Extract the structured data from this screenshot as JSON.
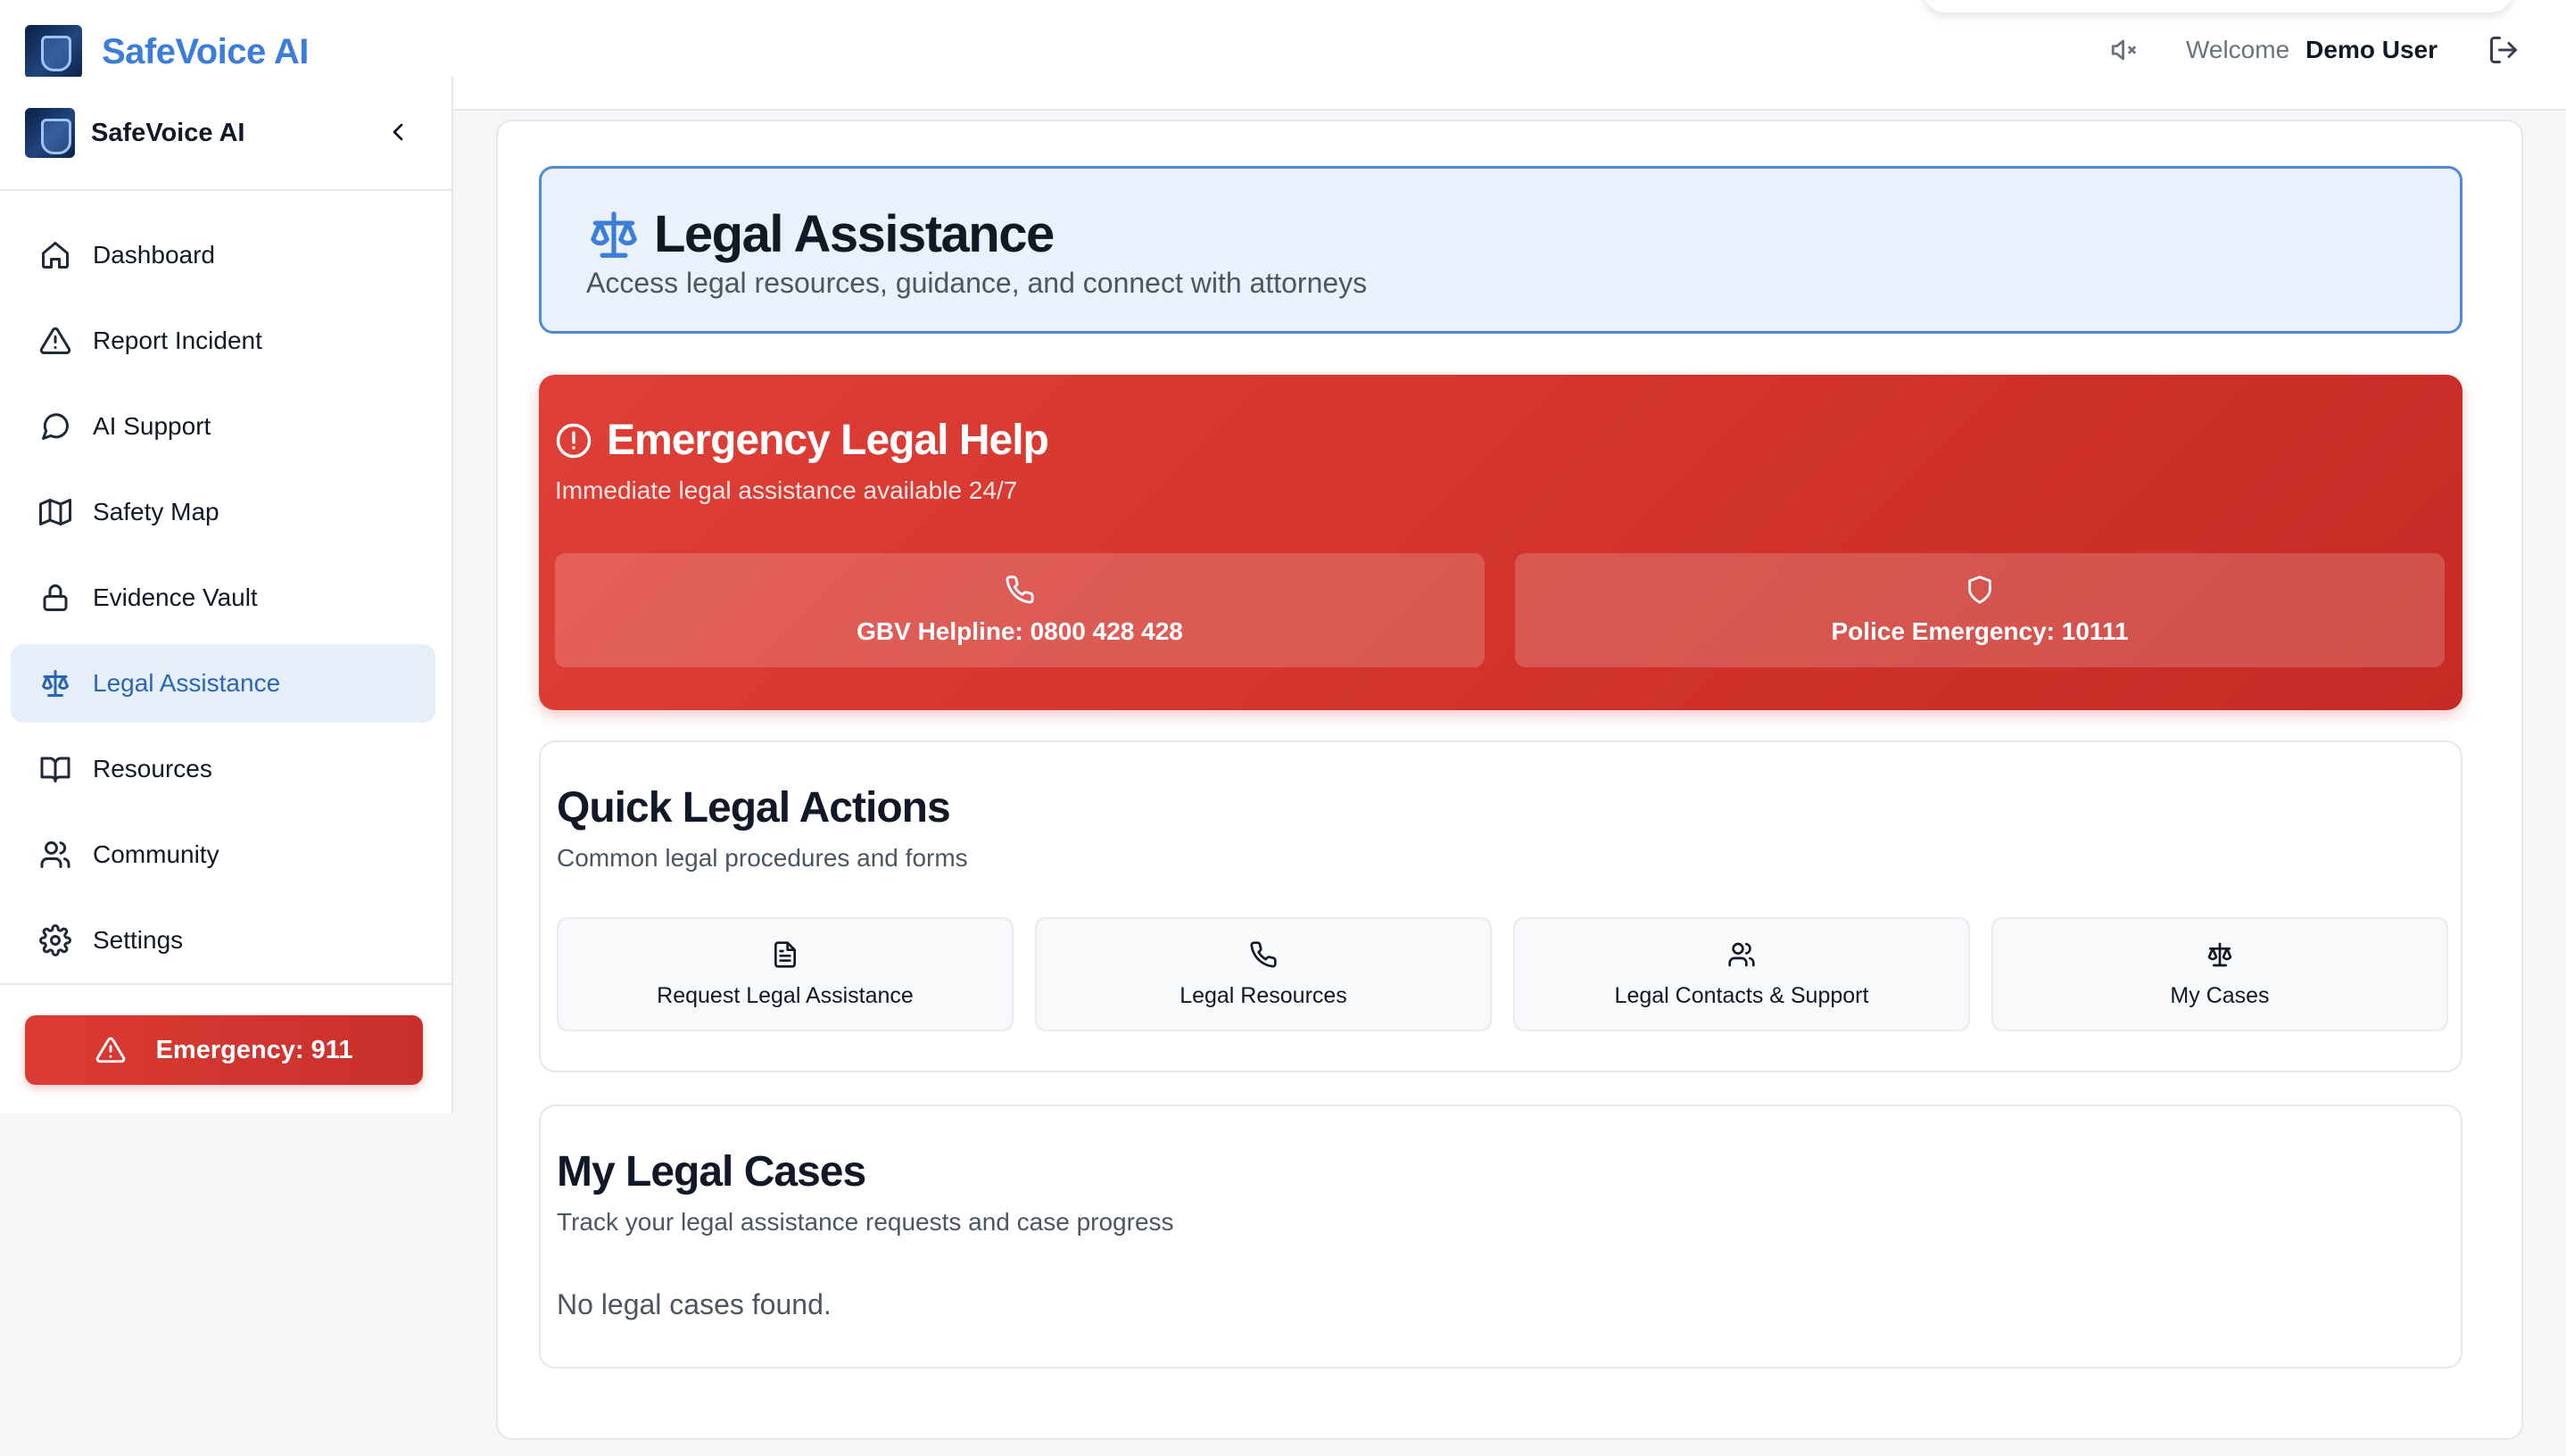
{
  "app": {
    "brand_name": "SafeVoice AI",
    "sidebar_title": "SafeVoice AI"
  },
  "header": {
    "welcome_label": "Welcome",
    "user_name": "Demo User"
  },
  "sidebar": {
    "items": [
      {
        "label": "Dashboard",
        "icon": "home-icon"
      },
      {
        "label": "Report Incident",
        "icon": "warning-triangle-icon"
      },
      {
        "label": "AI Support",
        "icon": "chat-bubble-icon"
      },
      {
        "label": "Safety Map",
        "icon": "map-icon"
      },
      {
        "label": "Evidence Vault",
        "icon": "lock-icon"
      },
      {
        "label": "Legal Assistance",
        "icon": "scales-icon",
        "active": true
      },
      {
        "label": "Resources",
        "icon": "book-icon"
      },
      {
        "label": "Community",
        "icon": "users-icon"
      },
      {
        "label": "Settings",
        "icon": "gear-icon"
      }
    ],
    "emergency_label": "Emergency: 911"
  },
  "page": {
    "title": "Legal Assistance",
    "subtitle": "Access legal resources, guidance, and connect with attorneys"
  },
  "emergency_help": {
    "title": "Emergency Legal Help",
    "subtitle": "Immediate legal assistance available 24/7",
    "buttons": [
      {
        "label": "GBV Helpline: 0800 428 428",
        "icon": "phone-icon"
      },
      {
        "label": "Police Emergency: 10111",
        "icon": "shield-icon"
      }
    ]
  },
  "quick_actions": {
    "title": "Quick Legal Actions",
    "subtitle": "Common legal procedures and forms",
    "items": [
      {
        "label": "Request Legal Assistance",
        "icon": "document-icon"
      },
      {
        "label": "Legal Resources",
        "icon": "phone-icon"
      },
      {
        "label": "Legal Contacts & Support",
        "icon": "users-icon"
      },
      {
        "label": "My Cases",
        "icon": "scales-icon"
      }
    ]
  },
  "legal_cases": {
    "title": "My Legal Cases",
    "subtitle": "Track your legal assistance requests and case progress",
    "empty_message": "No legal cases found."
  },
  "colors": {
    "brand_blue": "#3b7dd8",
    "emergency_red": "#d9372f",
    "active_nav_bg": "#e6eef9"
  }
}
